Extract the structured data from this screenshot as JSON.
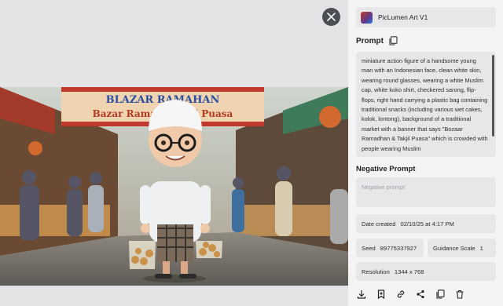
{
  "viewer": {
    "close_icon": "close-icon",
    "image_banner_line1": "BLAZAR RAMAHAN",
    "image_banner_line2": "Bazar Ramadh Kajil Puasa"
  },
  "panel": {
    "model_name": "PicLumen Art V1",
    "prompt_label": "Prompt",
    "prompt_text": "miniature action figure of a handsome young man with an Indonesian face, clean white skin, wearing round glasses, wearing a white Muslim cap, white koko shirt, checkered sarong, flip-flops, right hand carrying a plastic bag containing traditional snacks (including various wet cakes, kolok, lontong), background of a traditional market with a banner that says \"Bozaar Ramadhan & Takjil Puasa\" which is crowded with people wearing Muslim",
    "negative_label": "Negative Prompt",
    "negative_placeholder": "Negative prompt",
    "date_label": "Date created",
    "date_value": "02/10/25 at 4:17 PM",
    "seed_label": "Seed",
    "seed_value": "89775337927",
    "scale_label": "Guidance Scale",
    "scale_value": "1",
    "resolution_label": "Resolution",
    "resolution_value": "1344 x 768",
    "actions": [
      "download-icon",
      "bookmark-icon",
      "link-icon",
      "share-icon",
      "copy-icon",
      "delete-icon"
    ]
  }
}
